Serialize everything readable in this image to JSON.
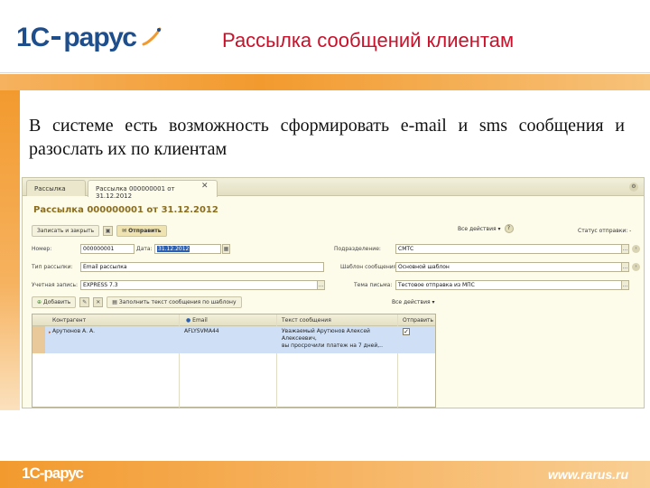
{
  "slide": {
    "title": "Рассылка сообщений клиентам",
    "body": "В системе есть возможность сформировать e-mail и sms сообщения и разослать их по клиентам",
    "logo_1c": "1С",
    "logo_rarus": "рарус",
    "footer_logo": "1С-рарус",
    "footer_url": "www.rarus.ru"
  },
  "colors": {
    "title": "#c8112a",
    "accent_orange": "#f29a2e",
    "logo_blue": "#1f4e8c"
  },
  "window": {
    "tabs": [
      {
        "label": "Рассылка"
      },
      {
        "label": "Рассылка 000000001 от 31.12.2012",
        "close": "✕"
      }
    ],
    "doc_title": "Рассылка 000000001 от 31.12.2012",
    "toolbar": {
      "save_close": "Записать и закрыть",
      "send": "Отправить",
      "all_actions": "Все действия ▾",
      "help": "?",
      "status": "Статус отправки: -"
    },
    "form": {
      "number_label": "Номер:",
      "number_value": "000000001",
      "date_label": "Дата:",
      "date_value": "31.12.2012",
      "type_label": "Тип рассылки:",
      "type_value": "Email рассылка",
      "account_label": "Учетная запись:",
      "account_value": "EXPRESS 7.3",
      "division_label": "Подразделение:",
      "division_value": "СМТС",
      "template_label": "Шаблон сообщения:",
      "template_value": "Основной шаблон",
      "subject_label": "Тема письма:",
      "subject_value": "Тестовое отправка из МПС"
    },
    "table_toolbar": {
      "add": "Добавить",
      "fill": "Заполнить текст сообщения по шаблону",
      "all_actions": "Все действия ▾"
    },
    "table": {
      "columns": [
        "Контрагент",
        "Email",
        "Текст сообщения",
        "Отправить"
      ],
      "rows": [
        {
          "client": "Арутюнов А. А.",
          "email": "AFLYSVMA44",
          "text_lines": [
            "Уважаемый Арутюнов Алексей",
            "Алексеевич,",
            "вы просрочили платеж на 7 дней,.."
          ],
          "send": "✓"
        }
      ]
    }
  }
}
